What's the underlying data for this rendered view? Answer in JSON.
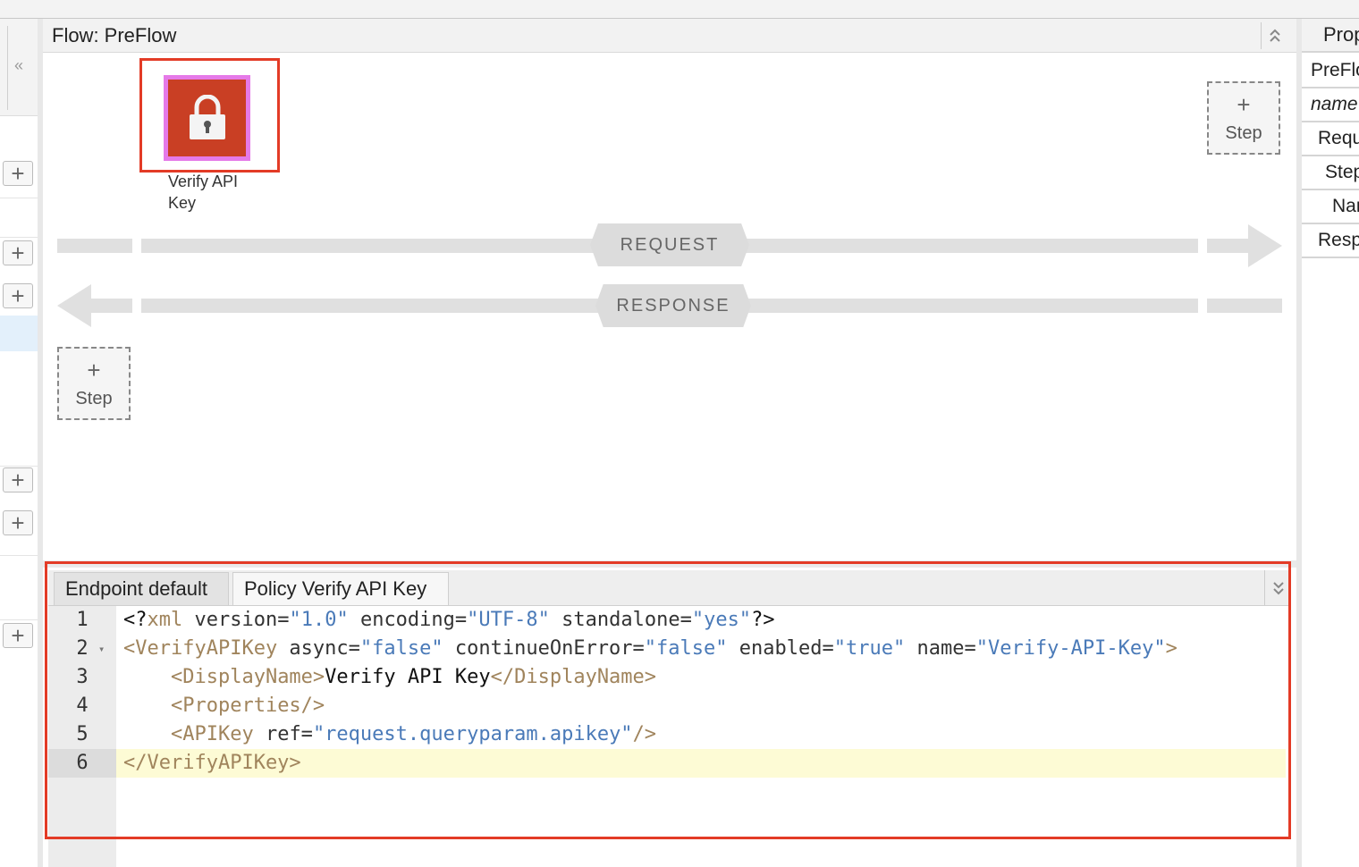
{
  "flow": {
    "title": "Flow: PreFlow",
    "policy_label": "Verify API Key",
    "step_label": "Step",
    "step_plus": "+",
    "request_label": "REQUEST",
    "response_label": "RESPONSE",
    "collapse_glyph": "«",
    "header_glyph": "⌃"
  },
  "editor": {
    "tabs": [
      {
        "label": "Endpoint default"
      },
      {
        "label": "Policy Verify API Key"
      }
    ],
    "menu_glyph": "⌄",
    "lines": [
      {
        "n": "1",
        "parts": [
          [
            "plain",
            "<?"
          ],
          [
            "tag",
            "xml"
          ],
          [
            "attr",
            " version="
          ],
          [
            "val",
            "\"1.0\""
          ],
          [
            "attr",
            " encoding="
          ],
          [
            "val",
            "\"UTF-8\""
          ],
          [
            "attr",
            " standalone="
          ],
          [
            "val",
            "\"yes\""
          ],
          [
            "plain",
            "?>"
          ]
        ]
      },
      {
        "n": "2",
        "parts": [
          [
            "tag",
            "<VerifyAPIKey"
          ],
          [
            "attr",
            " async="
          ],
          [
            "val",
            "\"false\""
          ],
          [
            "attr",
            " continueOnError="
          ],
          [
            "val",
            "\"false\""
          ],
          [
            "attr",
            " enabled="
          ],
          [
            "val",
            "\"true\""
          ],
          [
            "attr",
            " name="
          ],
          [
            "val",
            "\"Verify-API-Key\""
          ],
          [
            "tag",
            ">"
          ]
        ]
      },
      {
        "n": "3",
        "parts": [
          [
            "plain",
            "    "
          ],
          [
            "tag",
            "<DisplayName>"
          ],
          [
            "plain",
            "Verify API Key"
          ],
          [
            "tag",
            "</DisplayName>"
          ]
        ]
      },
      {
        "n": "4",
        "parts": [
          [
            "plain",
            "    "
          ],
          [
            "tag",
            "<Properties/>"
          ]
        ]
      },
      {
        "n": "5",
        "parts": [
          [
            "plain",
            "    "
          ],
          [
            "tag",
            "<APIKey"
          ],
          [
            "attr",
            " ref="
          ],
          [
            "val",
            "\"request.queryparam.apikey\""
          ],
          [
            "tag",
            "/>"
          ]
        ]
      },
      {
        "n": "6",
        "parts": [
          [
            "tag",
            "</VerifyAPIKey>"
          ]
        ]
      }
    ]
  },
  "properties": {
    "title": "Prop",
    "rows": [
      "PreFlo",
      "name",
      "Requ",
      "Step",
      "Nar",
      "Resp"
    ]
  },
  "left_nav": {
    "plus_glyph": "+"
  },
  "colors": {
    "highlight_border": "#e33b26",
    "policy_icon_bg": "#c93f24",
    "policy_icon_border": "#e57ae8",
    "xml_tag": "#a0845c",
    "xml_value": "#4a7ab8",
    "active_line": "#fdfbd5"
  }
}
